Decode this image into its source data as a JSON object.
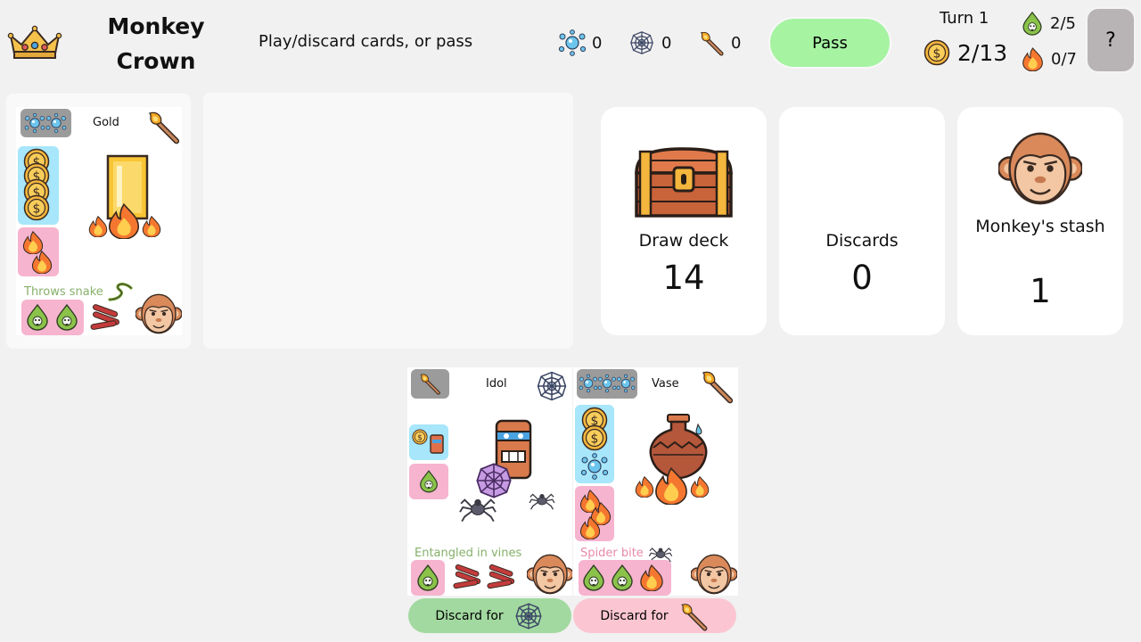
{
  "header": {
    "title": "Monkey Crown",
    "instruction": "Play/discard cards, or pass",
    "resources": [
      {
        "icon": "water-splash-icon",
        "count": "0"
      },
      {
        "icon": "spider-web-icon",
        "count": "0"
      },
      {
        "icon": "torch-icon",
        "count": "0"
      }
    ],
    "pass_label": "Pass",
    "turn": "Turn 1",
    "coins": "2/13",
    "poison": "2/5",
    "fire": "0/7",
    "help_label": "?"
  },
  "piles": {
    "draw": {
      "label": "Draw deck",
      "count": "14",
      "icon": "treasure-chest-icon"
    },
    "discards": {
      "label": "Discards",
      "count": "0"
    },
    "stash": {
      "label": "Monkey's stash",
      "count": "1",
      "icon": "monkey-face-icon"
    }
  },
  "cards": {
    "gold": {
      "name": "Gold",
      "caption": "Throws snake"
    },
    "idol": {
      "name": "Idol",
      "caption": "Entangled in vines"
    },
    "vase": {
      "name": "Vase",
      "caption": "Spider bite"
    }
  },
  "actions": {
    "discard_web": "Discard for",
    "discard_torch": "Discard for"
  },
  "colors": {
    "pass_button": "#a6f3a2",
    "discard_green": "#a2d9a0",
    "discard_pink": "#fbc6d2",
    "tile_blue": "#a7e6fb",
    "tile_pink": "#f6b4cf",
    "tile_grey": "#9b9b9b"
  }
}
